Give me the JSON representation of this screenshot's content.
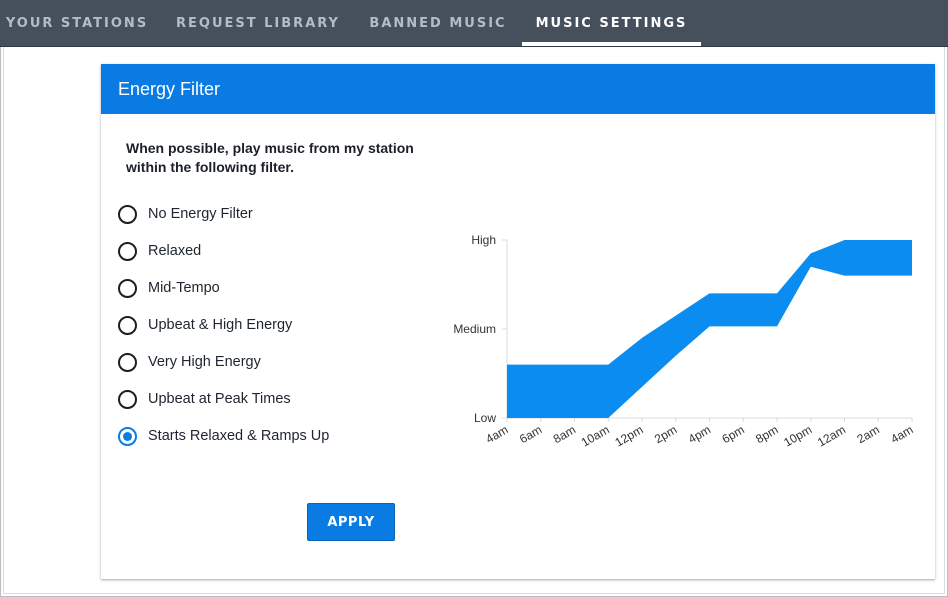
{
  "nav": {
    "tabs": [
      {
        "label": "YOUR STATIONS",
        "active": false
      },
      {
        "label": "REQUEST LIBRARY",
        "active": false
      },
      {
        "label": "BANNED MUSIC",
        "active": false
      },
      {
        "label": "MUSIC SETTINGS",
        "active": true
      }
    ]
  },
  "card": {
    "title": "Energy Filter",
    "description": "When possible, play music from my station within the following filter.",
    "options": [
      {
        "label": "No Energy Filter",
        "selected": false
      },
      {
        "label": "Relaxed",
        "selected": false
      },
      {
        "label": "Mid-Tempo",
        "selected": false
      },
      {
        "label": "Upbeat & High Energy",
        "selected": false
      },
      {
        "label": "Very High Energy",
        "selected": false
      },
      {
        "label": "Upbeat at Peak Times",
        "selected": false
      },
      {
        "label": "Starts Relaxed & Ramps Up",
        "selected": true
      }
    ],
    "apply_label": "APPLY"
  },
  "colors": {
    "accent": "#0a7be3",
    "nav_bg": "#46505d",
    "band": "#0a8cf0"
  },
  "chart_data": {
    "type": "area",
    "x": [
      "4am",
      "6am",
      "8am",
      "10am",
      "12pm",
      "2pm",
      "4pm",
      "6pm",
      "8pm",
      "10pm",
      "12am",
      "2am",
      "4am"
    ],
    "y_ticks": [
      "Low",
      "Medium",
      "High"
    ],
    "ylim": [
      0,
      2
    ],
    "series": [
      {
        "lower": [
          0,
          0,
          0,
          0,
          0.35,
          0.7,
          1.03,
          1.03,
          1.03,
          1.7,
          1.6,
          1.6,
          1.6
        ],
        "upper": [
          0.6,
          0.6,
          0.6,
          0.6,
          0.9,
          1.15,
          1.4,
          1.4,
          1.4,
          1.85,
          2,
          2,
          2
        ]
      }
    ]
  }
}
